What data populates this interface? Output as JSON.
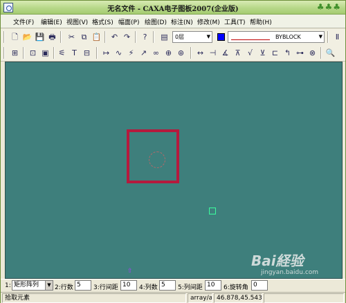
{
  "window": {
    "title": "无名文件 - CAXA电子图板2007(企业版)"
  },
  "menubar": {
    "items": [
      "文件(F)",
      "编辑(E)",
      "视图(V)",
      "格式(S)",
      "幅面(P)",
      "绘图(D)",
      "标注(N)",
      "修改(M)",
      "工具(T)",
      "帮助(H)"
    ]
  },
  "toolbar1": {
    "layer": "0层",
    "linetype": "BYBLOCK",
    "color": "#0000ff"
  },
  "command": {
    "opt1_label": "1:",
    "opt1_value": "矩形阵列",
    "opt2_label": "2:行数",
    "opt2_value": "5",
    "opt3_label": "3:行间距",
    "opt3_value": "10",
    "opt4_label": "4:列数",
    "opt4_value": "5",
    "opt5_label": "5:列间距",
    "opt5_value": "10",
    "opt6_label": "6:旋转角",
    "opt6_value": "0"
  },
  "status": {
    "prompt": "拾取元素",
    "command_name": "array/ar",
    "coordinates": "46.878,45.543"
  },
  "watermark": {
    "text": "Bai経验",
    "sub": "jingyan.baidu.com"
  }
}
